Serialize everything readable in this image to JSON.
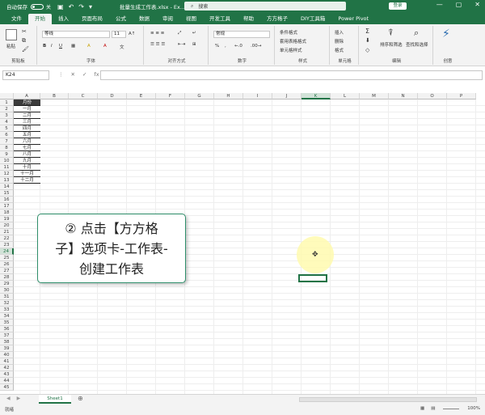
{
  "titlebar": {
    "autosave_label": "自动保存",
    "autosave_state": "关",
    "qat_icons": [
      "save-icon",
      "undo-icon",
      "redo-icon",
      "customize-icon"
    ],
    "doc_title": "批量生成工作表.xlsx - Ex...",
    "search_placeholder": "搜索",
    "login_label": "登录",
    "window_controls": [
      "—",
      "▢",
      "✕"
    ]
  },
  "tabs": [
    "文件",
    "开始",
    "插入",
    "页面布局",
    "公式",
    "数据",
    "审阅",
    "视图",
    "开发工具",
    "帮助",
    "方方格子",
    "DIY工具箱",
    "Power Pivot"
  ],
  "active_tab": "开始",
  "ribbon": {
    "clipboard": {
      "label": "剪贴板",
      "paste": "粘贴"
    },
    "font": {
      "label": "字体",
      "font_name": "等线",
      "font_size": "11",
      "buttons": [
        "B",
        "I",
        "U",
        "A",
        "A"
      ]
    },
    "alignment": {
      "label": "对齐方式"
    },
    "number": {
      "label": "数字",
      "format": "常规",
      "buttons": [
        "%",
        ",",
        "←.0",
        ".00→"
      ]
    },
    "styles": {
      "label": "样式",
      "items": [
        "条件格式",
        "套用表格格式",
        "单元格样式"
      ]
    },
    "cells": {
      "label": "单元格",
      "items": [
        "插入",
        "删除",
        "格式"
      ]
    },
    "editing": {
      "label": "编辑",
      "items": [
        "排序和筛选",
        "查找和选择"
      ]
    },
    "ideas": {
      "label": "创意"
    }
  },
  "formula_bar": {
    "name_box": "K24",
    "icons": [
      "⋮",
      "✕",
      "✓",
      "fx"
    ],
    "value": ""
  },
  "columns": [
    "A",
    "B",
    "C",
    "D",
    "E",
    "F",
    "G",
    "H",
    "I",
    "J",
    "K",
    "L",
    "M",
    "N",
    "O",
    "P"
  ],
  "selected_column": "K",
  "rows": [
    "1",
    "2",
    "3",
    "4",
    "5",
    "6",
    "7",
    "8",
    "9",
    "10",
    "11",
    "12",
    "13",
    "14",
    "15",
    "16",
    "17",
    "18",
    "19",
    "20",
    "21",
    "22",
    "23",
    "24",
    "25",
    "26",
    "27",
    "28",
    "29",
    "30",
    "31",
    "32",
    "33",
    "34",
    "35",
    "36",
    "37",
    "38",
    "39",
    "40",
    "41",
    "42",
    "43",
    "44",
    "45"
  ],
  "selected_row": "24",
  "column_a_cells": [
    "月份",
    "一月",
    "二月",
    "三月",
    "四月",
    "五月",
    "六月",
    "七月",
    "八月",
    "九月",
    "十月",
    "十一月",
    "十二月"
  ],
  "callout": {
    "line1": "② 点击【方方格",
    "line2": "子】选项卡-工作表-",
    "line3": "创建工作表"
  },
  "sheet_tabs": [
    "Sheet1"
  ],
  "add_sheet": "⊕",
  "status": {
    "ready": "就绪",
    "zoom": "100%"
  }
}
